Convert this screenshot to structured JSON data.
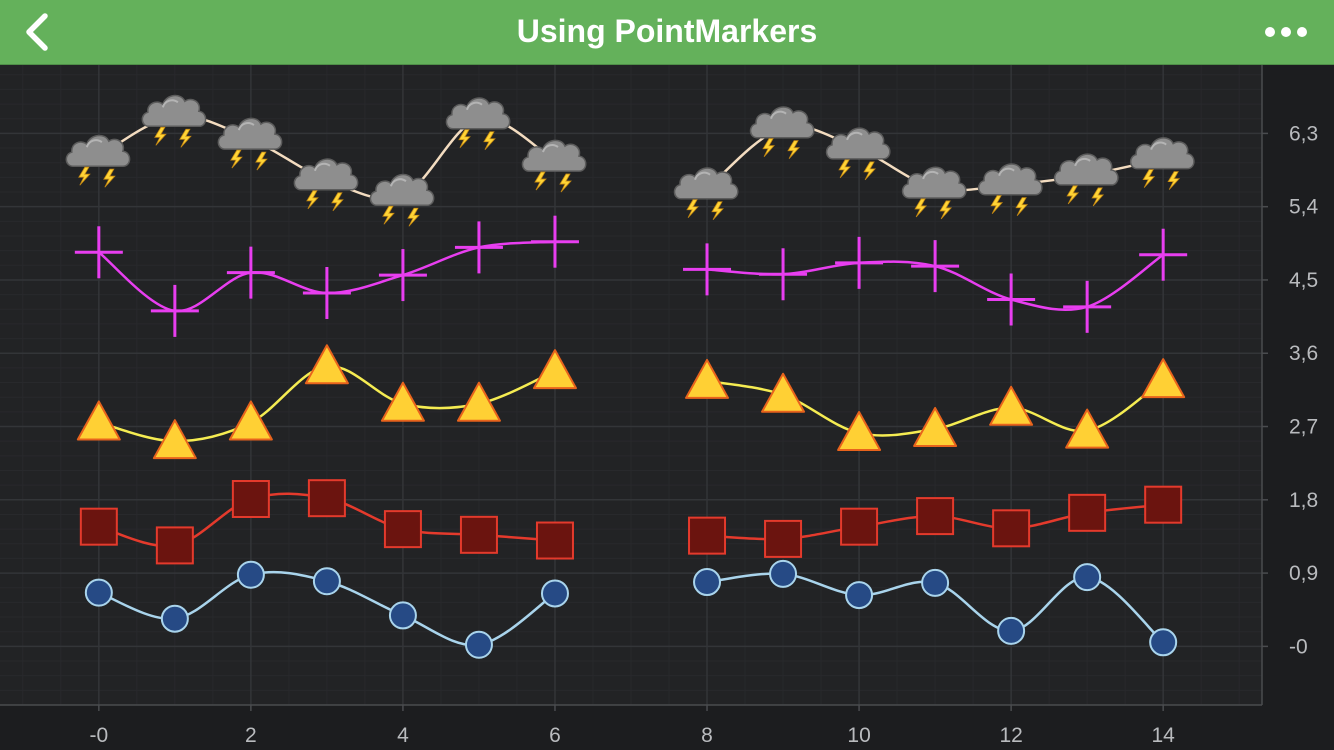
{
  "header": {
    "title": "Using PointMarkers",
    "back_icon": "chevron-left-icon",
    "more_icon": "more-horizontal-icon"
  },
  "chart_data": {
    "type": "line",
    "title": "",
    "xlabel": "",
    "ylabel": "",
    "x": [
      0,
      1,
      2,
      3,
      4,
      5,
      6,
      8,
      9,
      10,
      11,
      12,
      13,
      14
    ],
    "xlim": [
      -1.3,
      15.3
    ],
    "ylim": [
      -0.72,
      7.14
    ],
    "x_ticks": [
      0,
      2,
      4,
      6,
      8,
      10,
      12,
      14
    ],
    "x_tick_labels": [
      "-0",
      "2",
      "4",
      "6",
      "8",
      "10",
      "12",
      "14"
    ],
    "y_ticks": [
      0,
      0.9,
      1.8,
      2.7,
      3.6,
      4.5,
      5.4,
      6.3
    ],
    "y_tick_labels": [
      "-0",
      "0,9",
      "1,8",
      "2,7",
      "3,6",
      "4,5",
      "5,4",
      "6,3"
    ],
    "y_axis_position": "right",
    "grid": true,
    "legend": "none",
    "colors": {
      "background": "#1c1d1f",
      "plot_area": "#222325",
      "grid_major": "#333538",
      "grid_minor": "#28292c",
      "axis": "#4a4c4f"
    },
    "series": [
      {
        "marker": "ellipse",
        "line_color": "#a9d4ec",
        "marker_fill": "#264a85",
        "marker_stroke": "#a9d4ec",
        "values": [
          0.66,
          0.34,
          0.88,
          0.8,
          0.38,
          0.02,
          0.65,
          0.79,
          0.89,
          0.63,
          0.78,
          0.19,
          0.85,
          0.05
        ]
      },
      {
        "marker": "square",
        "line_color": "#e43a2c",
        "marker_fill": "#6b140f",
        "marker_stroke": "#e43a2c",
        "values": [
          1.47,
          1.24,
          1.81,
          1.82,
          1.44,
          1.37,
          1.3,
          1.36,
          1.32,
          1.47,
          1.6,
          1.45,
          1.64,
          1.74
        ]
      },
      {
        "marker": "triangle",
        "line_color": "#f5ec52",
        "marker_fill": "#ffd034",
        "marker_stroke": "#e8631c",
        "values": [
          2.75,
          2.52,
          2.75,
          3.44,
          2.98,
          2.98,
          3.38,
          3.26,
          3.09,
          2.62,
          2.67,
          2.93,
          2.65,
          3.27
        ]
      },
      {
        "marker": "cross",
        "line_color": "#e83ef0",
        "marker_fill": "#e83ef0",
        "marker_stroke": "#e83ef0",
        "values": [
          4.84,
          4.12,
          4.59,
          4.34,
          4.56,
          4.9,
          4.97,
          4.63,
          4.57,
          4.71,
          4.67,
          4.26,
          4.17,
          4.81
        ]
      },
      {
        "marker": "storm-cloud-icon",
        "line_color": "#f3dcc0",
        "marker_fill": "#8e8e8e",
        "marker_stroke": "#ffd436",
        "values": [
          6.02,
          6.51,
          6.23,
          5.73,
          5.54,
          6.48,
          5.96,
          5.62,
          6.37,
          6.11,
          5.63,
          5.67,
          5.79,
          5.99
        ]
      }
    ]
  }
}
